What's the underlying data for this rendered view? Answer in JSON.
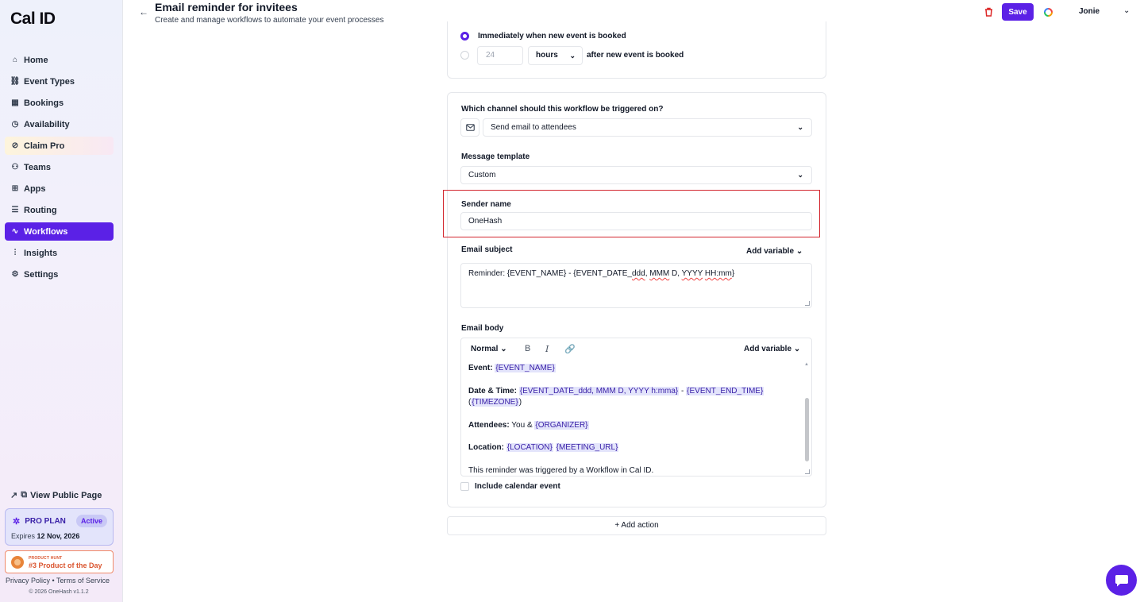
{
  "sidebar": {
    "logo": "Cal ID",
    "items": [
      {
        "label": "Home",
        "icon": "home-icon"
      },
      {
        "label": "Event Types",
        "icon": "link-icon"
      },
      {
        "label": "Bookings",
        "icon": "calendar-icon"
      },
      {
        "label": "Availability",
        "icon": "clock-icon"
      },
      {
        "label": "Claim Pro",
        "icon": "badge-icon"
      },
      {
        "label": "Teams",
        "icon": "users-icon"
      },
      {
        "label": "Apps",
        "icon": "grid-icon"
      },
      {
        "label": "Routing",
        "icon": "routing-icon"
      },
      {
        "label": "Workflows",
        "icon": "workflow-icon"
      },
      {
        "label": "Insights",
        "icon": "bar-chart-icon"
      },
      {
        "label": "Settings",
        "icon": "gear-icon"
      }
    ],
    "active_item": "Workflows",
    "public_page": "View Public Page",
    "plan": {
      "name": "PRO PLAN",
      "status": "Active",
      "expires_label": "Expires",
      "expires_date": "12 Nov, 2026"
    },
    "product_hunt": {
      "small": "PRODUCT HUNT",
      "big": "#3 Product of the Day"
    },
    "legal": "Privacy Policy • Terms of Service",
    "copyright": "© 2026 OneHash v1.1.2"
  },
  "header": {
    "title": "Email reminder for invitees",
    "subtitle": "Create and manage workflows to automate your event processes",
    "save_label": "Save",
    "user_name": "Jonie"
  },
  "trigger": {
    "option_immediate": "Immediately when new event is booked",
    "hours_value": "24",
    "hours_unit": "hours",
    "option_after": "after new event is booked"
  },
  "action": {
    "channel_label": "Which channel should this workflow be triggered on?",
    "channel_value": "Send email to attendees",
    "template_label": "Message template",
    "template_value": "Custom",
    "sender_label": "Sender name",
    "sender_value": "OneHash",
    "subject_label": "Email subject",
    "add_variable": "Add variable",
    "subject_value": {
      "prefix": "Reminder: {EVENT_NAME} - {EVENT_DATE_",
      "w1": "ddd",
      "s1": ", ",
      "w2": "MMM",
      "s2": " D, ",
      "w3": "YYYY",
      "s3": " ",
      "w4": "HH:mm",
      "suffix": "}"
    },
    "body_label": "Email body",
    "editor_format": "Normal",
    "body": {
      "event_label": "Event:",
      "event_var": "{EVENT_NAME}",
      "datetime_label": "Date & Time:",
      "datetime_var1": "{EVENT_DATE_ddd, MMM D, YYYY h:mma}",
      "datetime_sep": " - ",
      "datetime_var2": "{EVENT_END_TIME}",
      "tz_open": "(",
      "tz_var": "{TIMEZONE}",
      "tz_close": ")",
      "attendees_label": "Attendees:",
      "attendees_text": " You & ",
      "attendees_var": "{ORGANIZER}",
      "location_label": "Location:",
      "location_var1": "{LOCATION}",
      "location_var2": "{MEETING_URL}",
      "footer": "This reminder was triggered by a Workflow in Cal ID."
    },
    "calendar_label": "Include calendar event",
    "add_action": "+ Add action"
  },
  "colors": {
    "accent": "#5b21e6",
    "highlight": "#d3272f"
  }
}
